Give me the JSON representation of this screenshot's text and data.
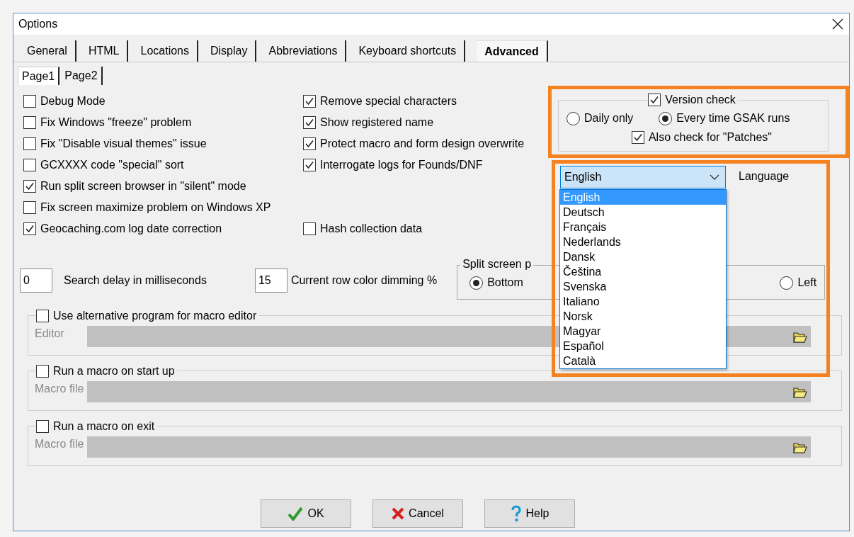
{
  "window": {
    "title": "Options"
  },
  "tabs": [
    {
      "label": "General",
      "selected": false
    },
    {
      "label": "HTML",
      "selected": false
    },
    {
      "label": "Locations",
      "selected": false
    },
    {
      "label": "Display",
      "selected": false
    },
    {
      "label": "Abbreviations",
      "selected": false
    },
    {
      "label": "Keyboard shortcuts",
      "selected": false
    },
    {
      "label": "Advanced",
      "selected": true
    }
  ],
  "subtabs": [
    {
      "label": "Page1",
      "selected": true
    },
    {
      "label": "Page2",
      "selected": false
    }
  ],
  "left_options": [
    {
      "label": "Debug Mode",
      "checked": false
    },
    {
      "label": "Fix Windows \"freeze\" problem",
      "checked": false
    },
    {
      "label": "Fix \"Disable visual themes\" issue",
      "checked": false
    },
    {
      "label": "GCXXXX code \"special\" sort",
      "checked": false
    },
    {
      "label": "Run split screen browser in \"silent\" mode",
      "checked": true
    },
    {
      "label": "Fix screen maximize problem on Windows XP",
      "checked": false
    },
    {
      "label": "Geocaching.com log date correction",
      "checked": true
    }
  ],
  "right_options": [
    {
      "label": "Remove special characters",
      "checked": true
    },
    {
      "label": "Show registered name",
      "checked": true
    },
    {
      "label": "Protect macro and form design overwrite",
      "checked": true
    },
    {
      "label": "Interrogate logs for Founds/DNF",
      "checked": true
    },
    {
      "label": "Hash collection data",
      "checked": false
    }
  ],
  "version_check": {
    "label": "Version check",
    "checked": true,
    "radios": [
      {
        "label": "Daily only",
        "selected": false
      },
      {
        "label": "Every time GSAK runs",
        "selected": true
      }
    ],
    "patches": {
      "label": "Also check for \"Patches\"",
      "checked": true
    }
  },
  "language": {
    "value": "English",
    "label": "Language",
    "options": [
      {
        "label": "English",
        "selected": true
      },
      {
        "label": "Deutsch",
        "selected": false
      },
      {
        "label": "Français",
        "selected": false
      },
      {
        "label": "Nederlands",
        "selected": false
      },
      {
        "label": "Dansk",
        "selected": false
      },
      {
        "label": "Čeština",
        "selected": false
      },
      {
        "label": "Svenska",
        "selected": false
      },
      {
        "label": "Italiano",
        "selected": false
      },
      {
        "label": "Norsk",
        "selected": false
      },
      {
        "label": "Magyar",
        "selected": false
      },
      {
        "label": "Español",
        "selected": false
      },
      {
        "label": "Català",
        "selected": false
      }
    ]
  },
  "search_delay": {
    "value": "0",
    "label": "Search delay in milliseconds"
  },
  "row_dimming": {
    "value": "15",
    "label": "Current row color dimming %"
  },
  "split_screen": {
    "title": "Split screen p",
    "options": [
      {
        "label": "Bottom",
        "selected": true
      },
      {
        "label": "Left",
        "selected": false
      }
    ]
  },
  "macro_groups": [
    {
      "label": "Use alternative program for macro editor",
      "checked": false,
      "field_label": "Editor"
    },
    {
      "label": "Run a macro on start up",
      "checked": false,
      "field_label": "Macro file"
    },
    {
      "label": "Run a macro on exit",
      "checked": false,
      "field_label": "Macro file"
    }
  ],
  "buttons": [
    {
      "label": "OK",
      "kind": "ok"
    },
    {
      "label": "Cancel",
      "kind": "cancel"
    },
    {
      "label": "Help",
      "kind": "help"
    }
  ]
}
